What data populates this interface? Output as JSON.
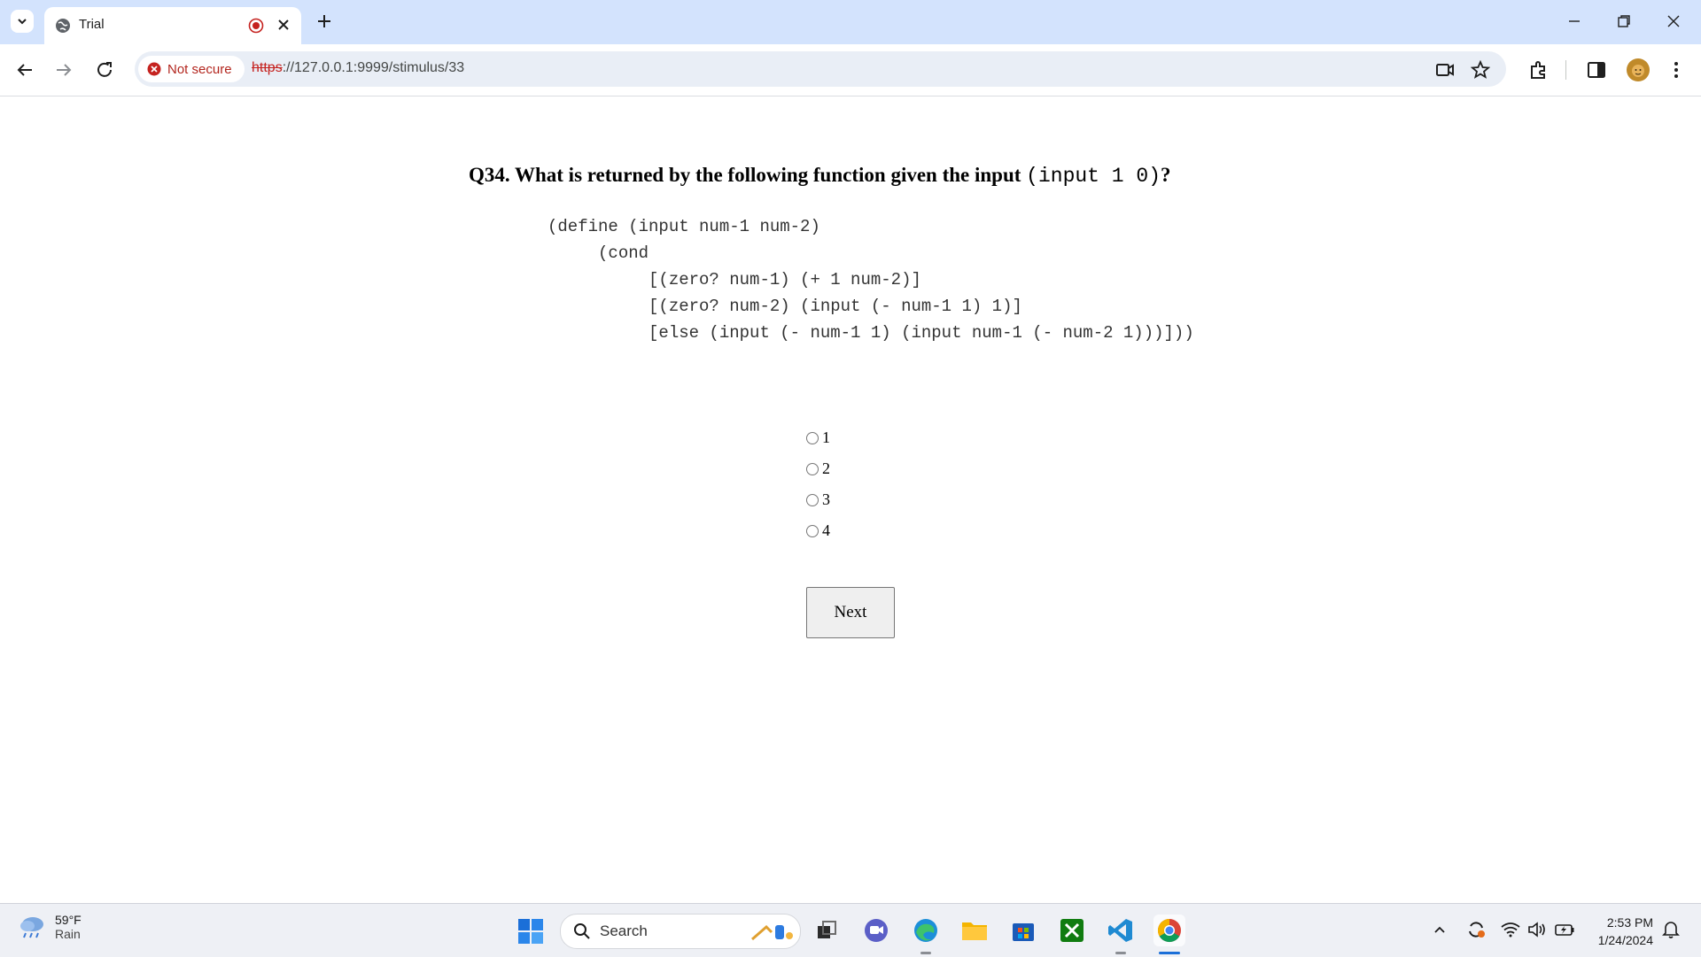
{
  "browser": {
    "tab_title": "Trial",
    "security_label": "Not secure",
    "url_scheme": "https",
    "url_rest": "://127.0.0.1:9999/stimulus/33"
  },
  "question": {
    "prefix": "Q34. What is returned by the following function given the input ",
    "code": "(input 1 0)",
    "suffix": "?"
  },
  "code_lines": [
    "(define (input num-1 num-2)",
    "     (cond",
    "          [(zero? num-1) (+ 1 num-2)]",
    "          [(zero? num-2) (input (- num-1 1) 1)]",
    "          [else (input (- num-1 1) (input num-1 (- num-2 1)))]))"
  ],
  "options": [
    "1",
    "2",
    "3",
    "4"
  ],
  "next_label": "Next",
  "taskbar": {
    "weather_temp": "59°F",
    "weather_cond": "Rain",
    "search_placeholder": "Search",
    "time": "2:53 PM",
    "date": "1/24/2024"
  },
  "colors": {
    "titlebar": "#d3e3fd",
    "omnibox": "#e9eef6",
    "not_secure": "#b3261e"
  }
}
